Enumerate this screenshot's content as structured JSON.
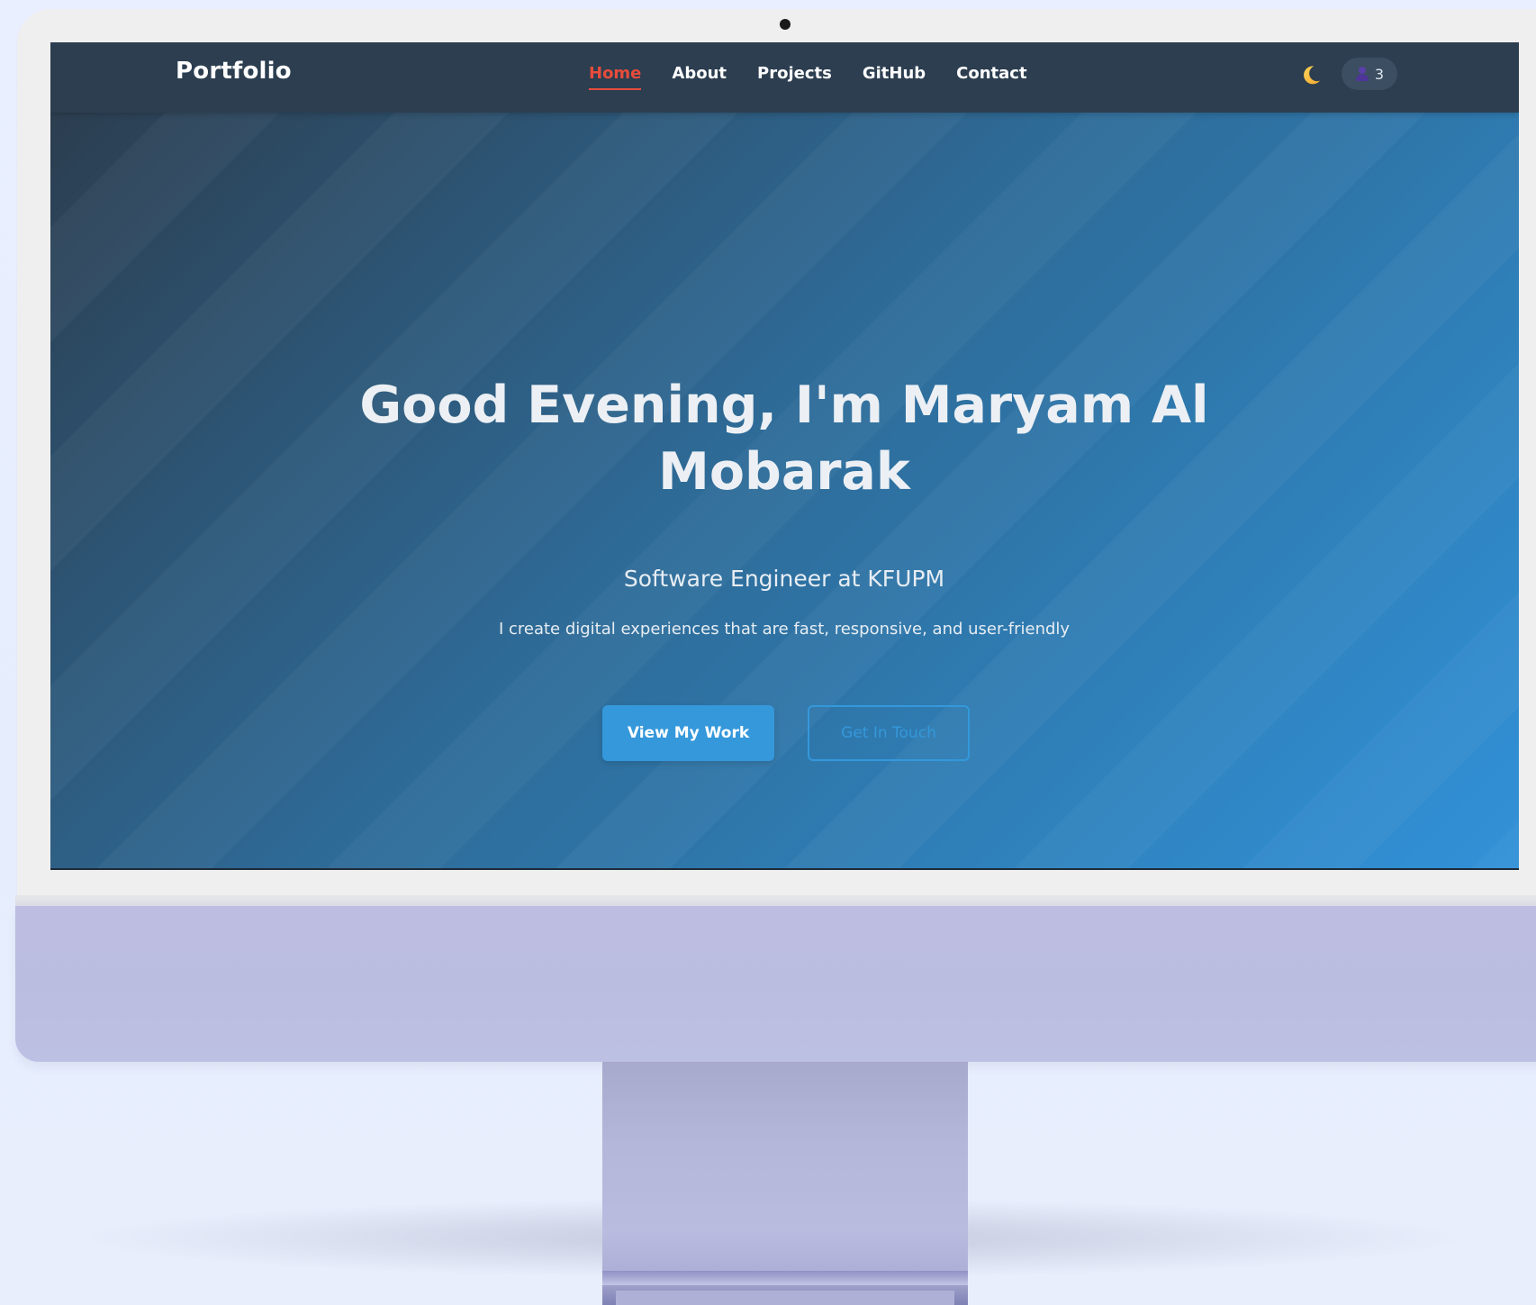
{
  "nav": {
    "brand": "Portfolio",
    "links": [
      {
        "label": "Home",
        "active": true
      },
      {
        "label": "About",
        "active": false
      },
      {
        "label": "Projects",
        "active": false
      },
      {
        "label": "GitHub",
        "active": false
      },
      {
        "label": "Contact",
        "active": false
      }
    ],
    "theme_icon": "moon-icon",
    "visitor_icon": "user-icon",
    "visitor_count": "3"
  },
  "hero": {
    "title": "Good Evening, I'm Maryam Al Mobarak",
    "subtitle": "Software Engineer at KFUPM",
    "tagline": "I create digital experiences that are fast, responsive, and user-friendly",
    "primary_button": "View My Work",
    "secondary_button": "Get In Touch"
  },
  "colors": {
    "navbar_bg": "#2c3e50",
    "accent_red": "#e74c3c",
    "accent_blue": "#3498db",
    "device_color": "#bcbde1"
  }
}
